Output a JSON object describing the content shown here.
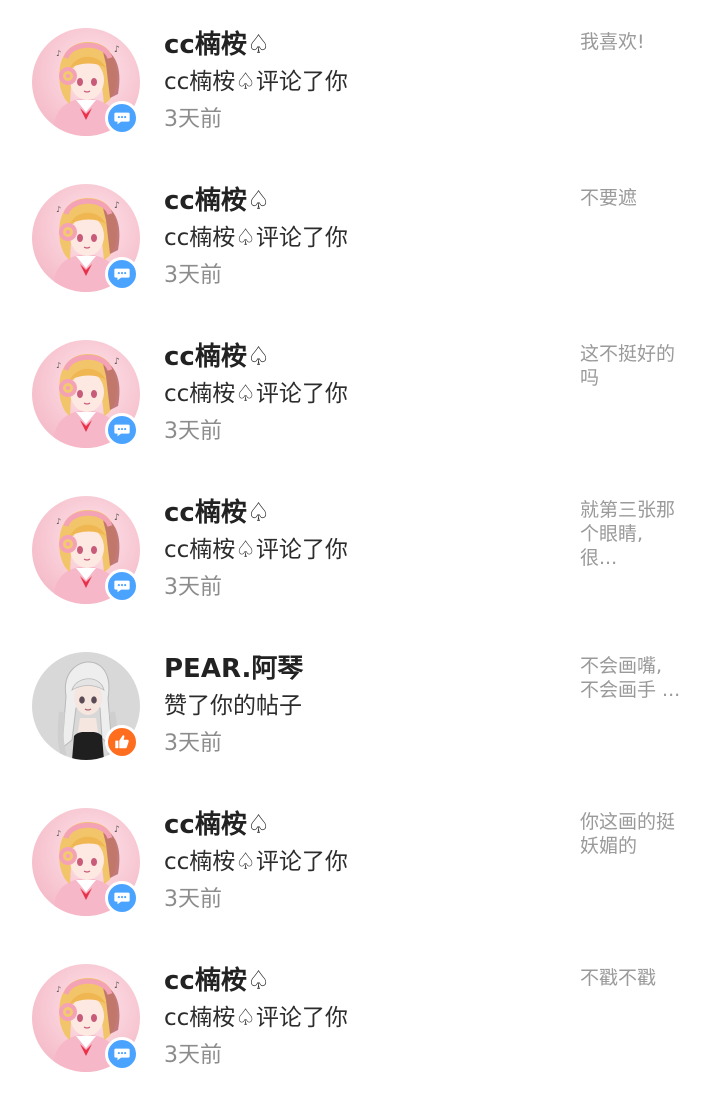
{
  "notifications": [
    {
      "avatar": "anime-girl-headphones-avatar",
      "user": "cc楠桉♤",
      "action": "cc楠桉♤评论了你",
      "time": "3天前",
      "badge": "comment",
      "preview": "我喜欢!"
    },
    {
      "avatar": "anime-girl-headphones-avatar",
      "user": "cc楠桉♤",
      "action": "cc楠桉♤评论了你",
      "time": "3天前",
      "badge": "comment",
      "preview": "不要遮"
    },
    {
      "avatar": "anime-girl-headphones-avatar",
      "user": "cc楠桉♤",
      "action": "cc楠桉♤评论了你",
      "time": "3天前",
      "badge": "comment",
      "preview": "这不挺好的\n吗"
    },
    {
      "avatar": "anime-girl-headphones-avatar",
      "user": "cc楠桉♤",
      "action": "cc楠桉♤评论了你",
      "time": "3天前",
      "badge": "comment",
      "preview": "就第三张那\n个眼睛,\n很..."
    },
    {
      "avatar": "anime-girl-gray-hair-avatar",
      "user": "PEAR.阿琴",
      "action": "赞了你的帖子",
      "time": "3天前",
      "badge": "like",
      "preview": "不会画嘴,\n不会画手 ..."
    },
    {
      "avatar": "anime-girl-headphones-avatar",
      "user": "cc楠桉♤",
      "action": "cc楠桉♤评论了你",
      "time": "3天前",
      "badge": "comment",
      "preview": "你这画的挺\n妖媚的"
    },
    {
      "avatar": "anime-girl-headphones-avatar",
      "user": "cc楠桉♤",
      "action": "cc楠桉♤评论了你",
      "time": "3天前",
      "badge": "comment",
      "preview": "不戳不戳"
    }
  ],
  "colors": {
    "comment_badge": "#4aa3ff",
    "like_badge": "#ff6d1f",
    "name_text": "#222222",
    "time_text": "#8c8c8c",
    "preview_text": "#9a9a9a"
  }
}
